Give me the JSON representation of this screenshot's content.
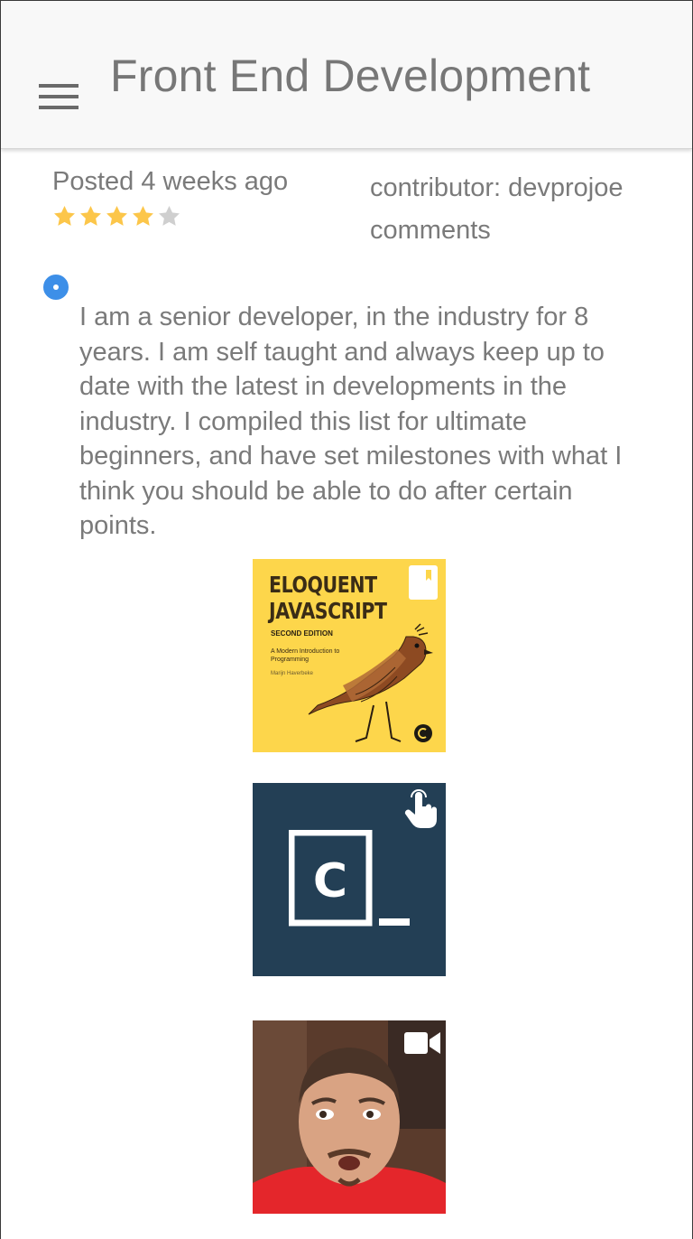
{
  "header": {
    "title": "Front End Development",
    "menu_icon": "hamburger-menu-icon"
  },
  "meta": {
    "posted": "Posted 4 weeks ago",
    "contributor": "contributor: devprojoe",
    "comments": "comments",
    "rating": {
      "value": 4,
      "max": 5,
      "filled_color": "#fcc64a",
      "empty_color": "#cfcfcf"
    }
  },
  "post": {
    "selected": true,
    "description": "I am a senior developer, in the industry for 8 years. I am self taught and always keep up to date with the latest in developments in the industry. I compiled this list for ultimate beginners, and have set milestones with what I think you should be able to do after certain points."
  },
  "resources": [
    {
      "type_icon": "bookmark-icon",
      "cover": {
        "title": "ELOQUENT JAVASCRIPT",
        "edition": "SECOND EDITION",
        "subtitle": "A Modern Introduction to Programming",
        "author": "Marijn Haverbeke"
      },
      "background": "#fdd64b"
    },
    {
      "type_icon": "touch-icon",
      "logo_letter": "C",
      "background": "#233f55"
    },
    {
      "type_icon": "video-camera-icon",
      "background": "#4a2f25"
    }
  ]
}
